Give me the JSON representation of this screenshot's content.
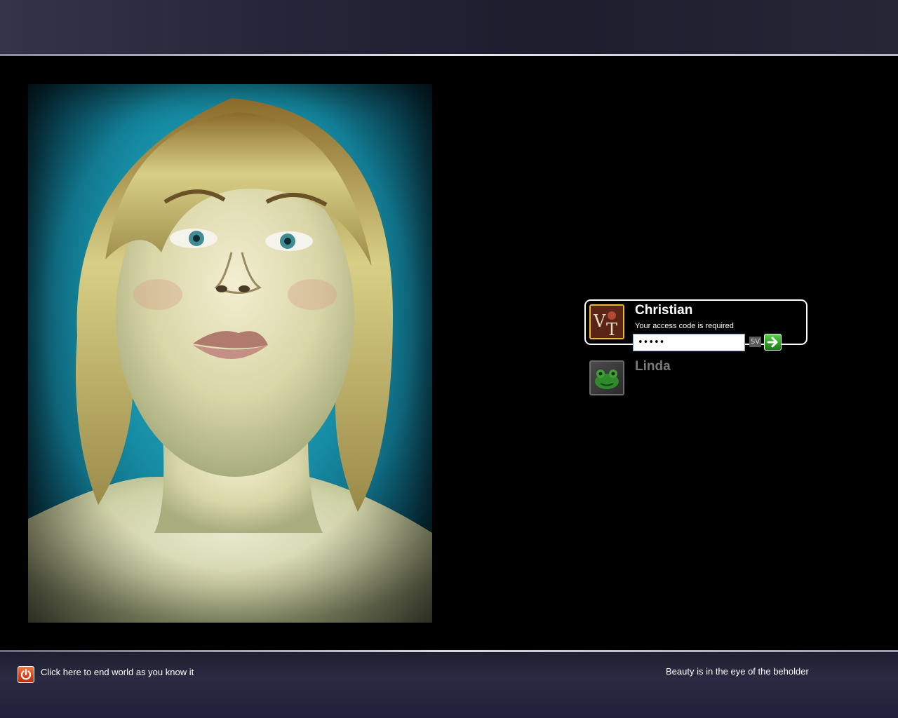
{
  "users": [
    {
      "name": "Christian",
      "status": "Your access code is required",
      "password_mask": "•••••",
      "selected": true,
      "avatar": "vt-monogram-icon"
    },
    {
      "name": "Linda",
      "selected": false,
      "avatar": "frog-icon"
    }
  ],
  "login": {
    "keyboard_language": "SV",
    "go_icon": "right-arrow-icon"
  },
  "footer": {
    "shutdown_label": "Click here to end world as you know it",
    "shutdown_icon": "power-icon",
    "tagline": "Beauty is in the eye of the beholder"
  },
  "colors": {
    "background": "#000000",
    "band": "#26263a",
    "selected_border": "#ffffff",
    "avatar_border_selected": "#e8b830",
    "inactive_name": "#7a7a7a",
    "go_green": "#2f9c22",
    "power_red": "#d8401a"
  }
}
